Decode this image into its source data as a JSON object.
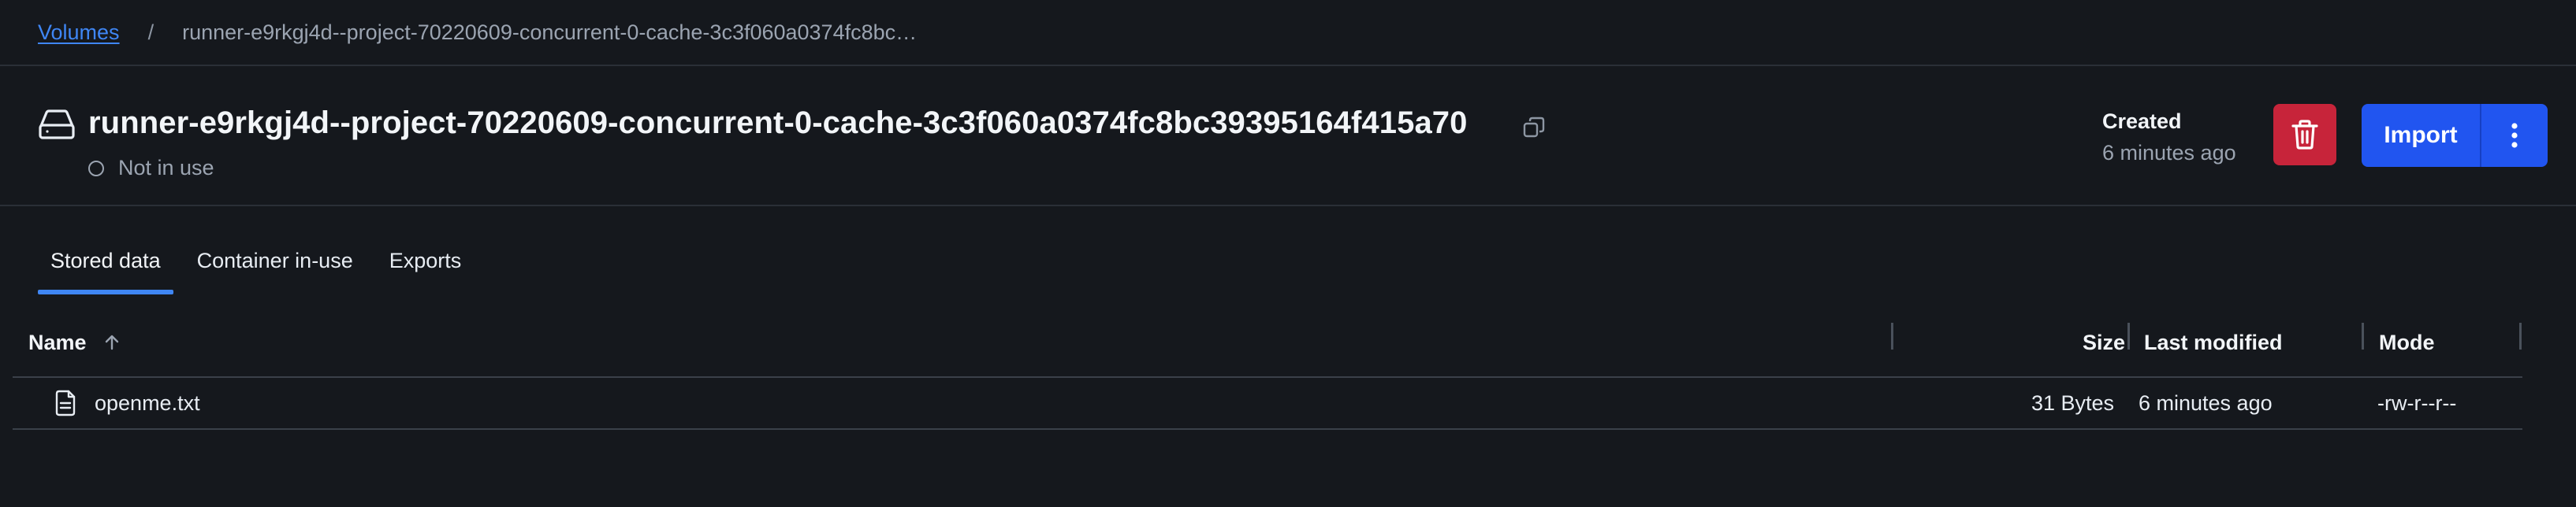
{
  "breadcrumb": {
    "root": "Volumes",
    "separator": "/",
    "current": "runner-e9rkgj4d--project-70220609-concurrent-0-cache-3c3f060a0374fc8bc…"
  },
  "volume": {
    "icon": "hard-drive-icon",
    "title": "runner-e9rkgj4d--project-70220609-concurrent-0-cache-3c3f060a0374fc8bc39395164f415a70",
    "status": "Not in use"
  },
  "created": {
    "label": "Created",
    "value": "6 minutes ago"
  },
  "actions": {
    "delete_icon": "trash-icon",
    "import_label": "Import",
    "more_icon": "vertical-ellipsis-icon"
  },
  "tabs": [
    {
      "label": "Stored data",
      "active": true
    },
    {
      "label": "Container in-use",
      "active": false
    },
    {
      "label": "Exports",
      "active": false
    }
  ],
  "table": {
    "columns": {
      "name": "Name",
      "size": "Size",
      "modified": "Last modified",
      "mode": "Mode"
    },
    "sort": {
      "column": "Name",
      "direction": "ascending"
    },
    "rows": [
      {
        "icon": "file-text-icon",
        "name": "openme.txt",
        "size": "31 Bytes",
        "modified": "6 minutes ago",
        "mode": "-rw-r--r--"
      }
    ]
  },
  "colors": {
    "background": "#15181d",
    "accent": "#3f86f4",
    "primary_button": "#2155f0",
    "danger_button": "#c7243a"
  }
}
